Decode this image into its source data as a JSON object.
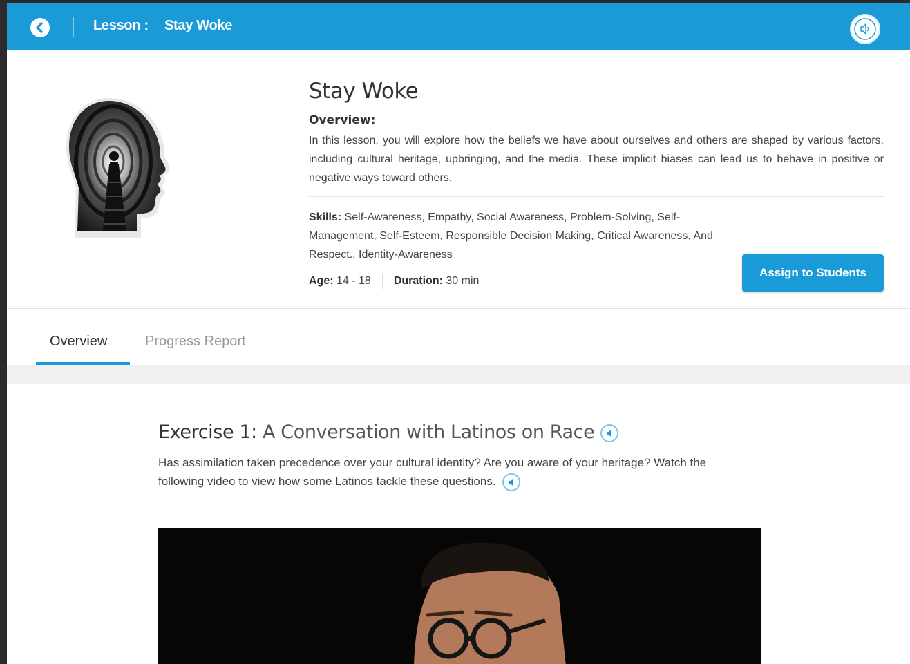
{
  "header": {
    "lesson_label": "Lesson :",
    "lesson_name": "Stay Woke",
    "back_icon": "chevron-left-icon",
    "audio_icon": "speaker-icon"
  },
  "lesson": {
    "title": "Stay Woke",
    "overview_label": "Overview:",
    "overview_text": "In this lesson, you will explore how the beliefs we have about ourselves and others are shaped by various factors, including cultural heritage, upbringing, and the media. These implicit biases can lead us to behave in positive or negative ways toward others.",
    "skills_label": "Skills:",
    "skills_text": " Self-Awareness, Empathy, Social Awareness, Problem-Solving, Self-Management, Self-Esteem, Responsible Decision Making, Critical Awareness, And Respect., Identity-Awareness",
    "age_label": "Age:",
    "age_value": " 14 - 18",
    "duration_label": "Duration:",
    "duration_value": " 30 min",
    "assign_button": "Assign to Students"
  },
  "tabs": [
    {
      "label": "Overview",
      "active": true
    },
    {
      "label": "Progress Report",
      "active": false
    }
  ],
  "exercise": {
    "number_label": "Exercise 1:",
    "name": " A Conversation with Latinos on Race",
    "description": "Has assimilation taken precedence over your cultural identity? Are you aware of your heritage? Watch the following video to view how some Latinos tackle these questions."
  },
  "colors": {
    "brand": "#1a9bd7",
    "accent_yellow": "#f2b233"
  }
}
